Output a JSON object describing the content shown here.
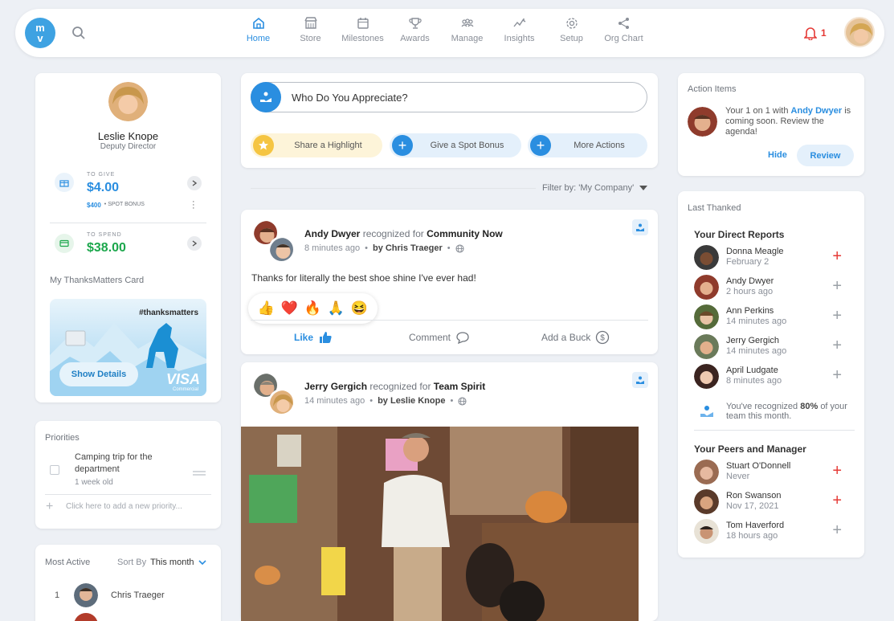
{
  "nav": {
    "logo": "m\nv",
    "items": [
      {
        "label": "Home",
        "icon": "home-icon",
        "active": true
      },
      {
        "label": "Store",
        "icon": "store-icon"
      },
      {
        "label": "Milestones",
        "icon": "calendar-icon"
      },
      {
        "label": "Awards",
        "icon": "trophy-icon"
      },
      {
        "label": "Manage",
        "icon": "people-icon"
      },
      {
        "label": "Insights",
        "icon": "chart-icon"
      },
      {
        "label": "Setup",
        "icon": "gear-icon"
      },
      {
        "label": "Org Chart",
        "icon": "share-icon"
      }
    ],
    "notification_count": "1"
  },
  "profile": {
    "name": "Leslie Knope",
    "role": "Deputy Director",
    "to_give_label": "TO GIVE",
    "to_give_amount": "$4.00",
    "spot_bonus_amount": "$400",
    "spot_bonus_label": "• SPOT BONUS",
    "to_spend_label": "TO SPEND",
    "to_spend_amount": "$38.00",
    "card_title": "My ThanksMatters Card",
    "card_tag": "#thanksmatters",
    "show_details": "Show Details",
    "card_brand": "VISA",
    "card_brand_sub": "Commercial"
  },
  "priorities": {
    "title": "Priorities",
    "item_text": "Camping trip for the department",
    "item_sub": "1 week old",
    "add_placeholder": "Click here to add a new priority..."
  },
  "most_active": {
    "title": "Most Active",
    "sort_label": "Sort By",
    "sort_value": "This month",
    "rows": [
      {
        "rank": "1",
        "name": "Chris Traeger"
      }
    ]
  },
  "composer": {
    "prompt": "Who Do You Appreciate?",
    "actions": [
      "Share a Highlight",
      "Give a Spot Bonus",
      "More Actions"
    ]
  },
  "filter": {
    "label": "Filter by: 'My Company'"
  },
  "posts": [
    {
      "person": "Andy Dwyer",
      "mid": "recognized for",
      "award": "Community Now",
      "time": "8 minutes ago",
      "by": "by Chris Traeger",
      "message": "Thanks for literally the best shoe shine I've ever had!",
      "reactions": [
        "👍",
        "❤️",
        "🔥",
        "🙏",
        "😆"
      ],
      "like": "Like",
      "comment": "Comment",
      "add_buck": "Add a Buck"
    },
    {
      "person": "Jerry Gergich",
      "mid": "recognized for",
      "award": "Team Spirit",
      "time": "14 minutes ago",
      "by": "by Leslie Knope"
    }
  ],
  "action_items": {
    "title": "Action Items",
    "text_before": "Your 1 on 1 with",
    "link_name": "Andy Dwyer",
    "text_after": "is coming soon. Review the agenda!",
    "hide": "Hide",
    "review": "Review"
  },
  "last_thanked": {
    "title": "Last Thanked",
    "direct_title": "Your Direct Reports",
    "direct": [
      {
        "name": "Donna Meagle",
        "sub": "February 2",
        "accent": "#e53935"
      },
      {
        "name": "Andy Dwyer",
        "sub": "2 hours ago",
        "accent": "#9aa0a6"
      },
      {
        "name": "Ann Perkins",
        "sub": "14 minutes ago",
        "accent": "#9aa0a6"
      },
      {
        "name": "Jerry Gergich",
        "sub": "14 minutes ago",
        "accent": "#9aa0a6"
      },
      {
        "name": "April Ludgate",
        "sub": "8 minutes ago",
        "accent": "#9aa0a6"
      }
    ],
    "progress_text_before": "You've recognized",
    "progress_percent": "80%",
    "progress_text_after": "of your team this month.",
    "peers_title": "Your Peers and Manager",
    "peers": [
      {
        "name": "Stuart O'Donnell",
        "sub": "Never",
        "accent": "#e53935"
      },
      {
        "name": "Ron Swanson",
        "sub": "Nov 17, 2021",
        "accent": "#e53935"
      },
      {
        "name": "Tom Haverford",
        "sub": "18 hours ago",
        "accent": "#9aa0a6"
      }
    ]
  },
  "colors": {
    "accent": "#2a8ee0",
    "money": "#1ca74c",
    "alert": "#e53935"
  }
}
